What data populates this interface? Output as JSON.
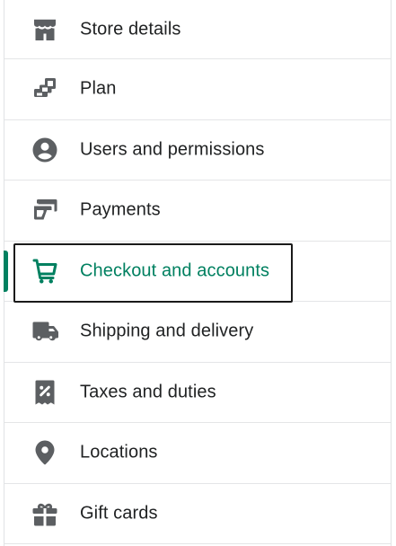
{
  "sidebar": {
    "items": [
      {
        "label": "Store details",
        "icon": "store-icon"
      },
      {
        "label": "Plan",
        "icon": "plan-icon"
      },
      {
        "label": "Users and permissions",
        "icon": "user-circle-icon"
      },
      {
        "label": "Payments",
        "icon": "payments-icon"
      },
      {
        "label": "Checkout and accounts",
        "icon": "cart-icon",
        "active": true
      },
      {
        "label": "Shipping and delivery",
        "icon": "truck-icon"
      },
      {
        "label": "Taxes and duties",
        "icon": "receipt-icon"
      },
      {
        "label": "Locations",
        "icon": "location-pin-icon"
      },
      {
        "label": "Gift cards",
        "icon": "gift-icon"
      }
    ]
  },
  "colors": {
    "icon": "#5c5f62",
    "text": "#202223",
    "active": "#008060",
    "divider": "#e4e5e7",
    "focus_ring": "#1a1a1a"
  }
}
